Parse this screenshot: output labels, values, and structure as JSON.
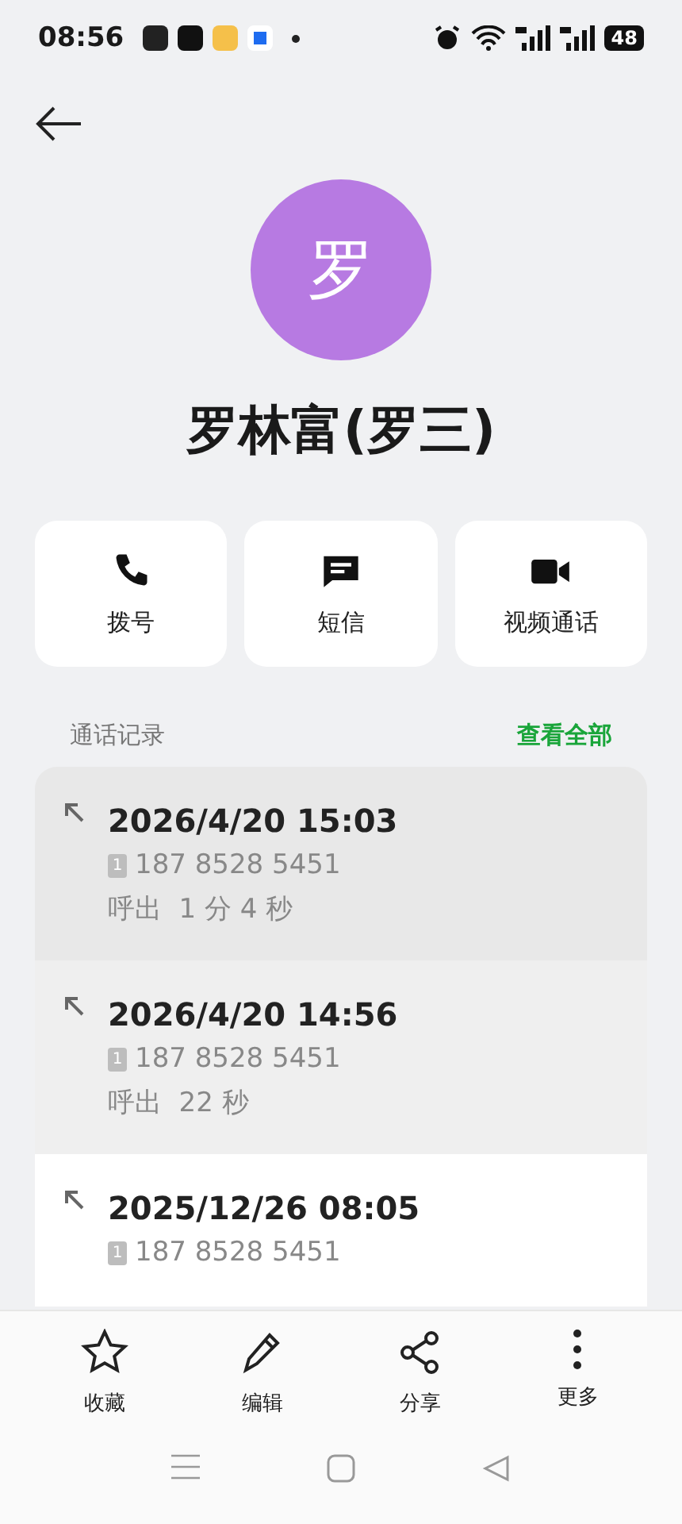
{
  "status_bar": {
    "time": "08:56",
    "battery": "48"
  },
  "contact": {
    "initial": "罗",
    "name": "罗林富(罗三)"
  },
  "actions": [
    {
      "kind": "call",
      "label": "拨号"
    },
    {
      "kind": "message",
      "label": "短信"
    },
    {
      "kind": "video",
      "label": "视频通话"
    }
  ],
  "call_log": {
    "title": "通话记录",
    "link": "查看全部",
    "entries": [
      {
        "kind": "pressed",
        "datetime": "2026/4/20 15:03",
        "sim": "1",
        "number": "187 8528 5451",
        "detail": "呼出  1 分 4 秒"
      },
      {
        "kind": "faded",
        "datetime": "2026/4/20 14:56",
        "sim": "1",
        "number": "187 8528 5451",
        "detail": "呼出  22 秒"
      },
      {
        "kind": "plain",
        "datetime": "2025/12/26 08:05",
        "sim": "1",
        "number": "187 8528 5451"
      }
    ]
  },
  "bottom_actions": [
    {
      "kind": "favorite",
      "label": "收藏"
    },
    {
      "kind": "edit",
      "label": "编辑"
    },
    {
      "kind": "share",
      "label": "分享"
    },
    {
      "kind": "more",
      "label": "更多"
    }
  ]
}
